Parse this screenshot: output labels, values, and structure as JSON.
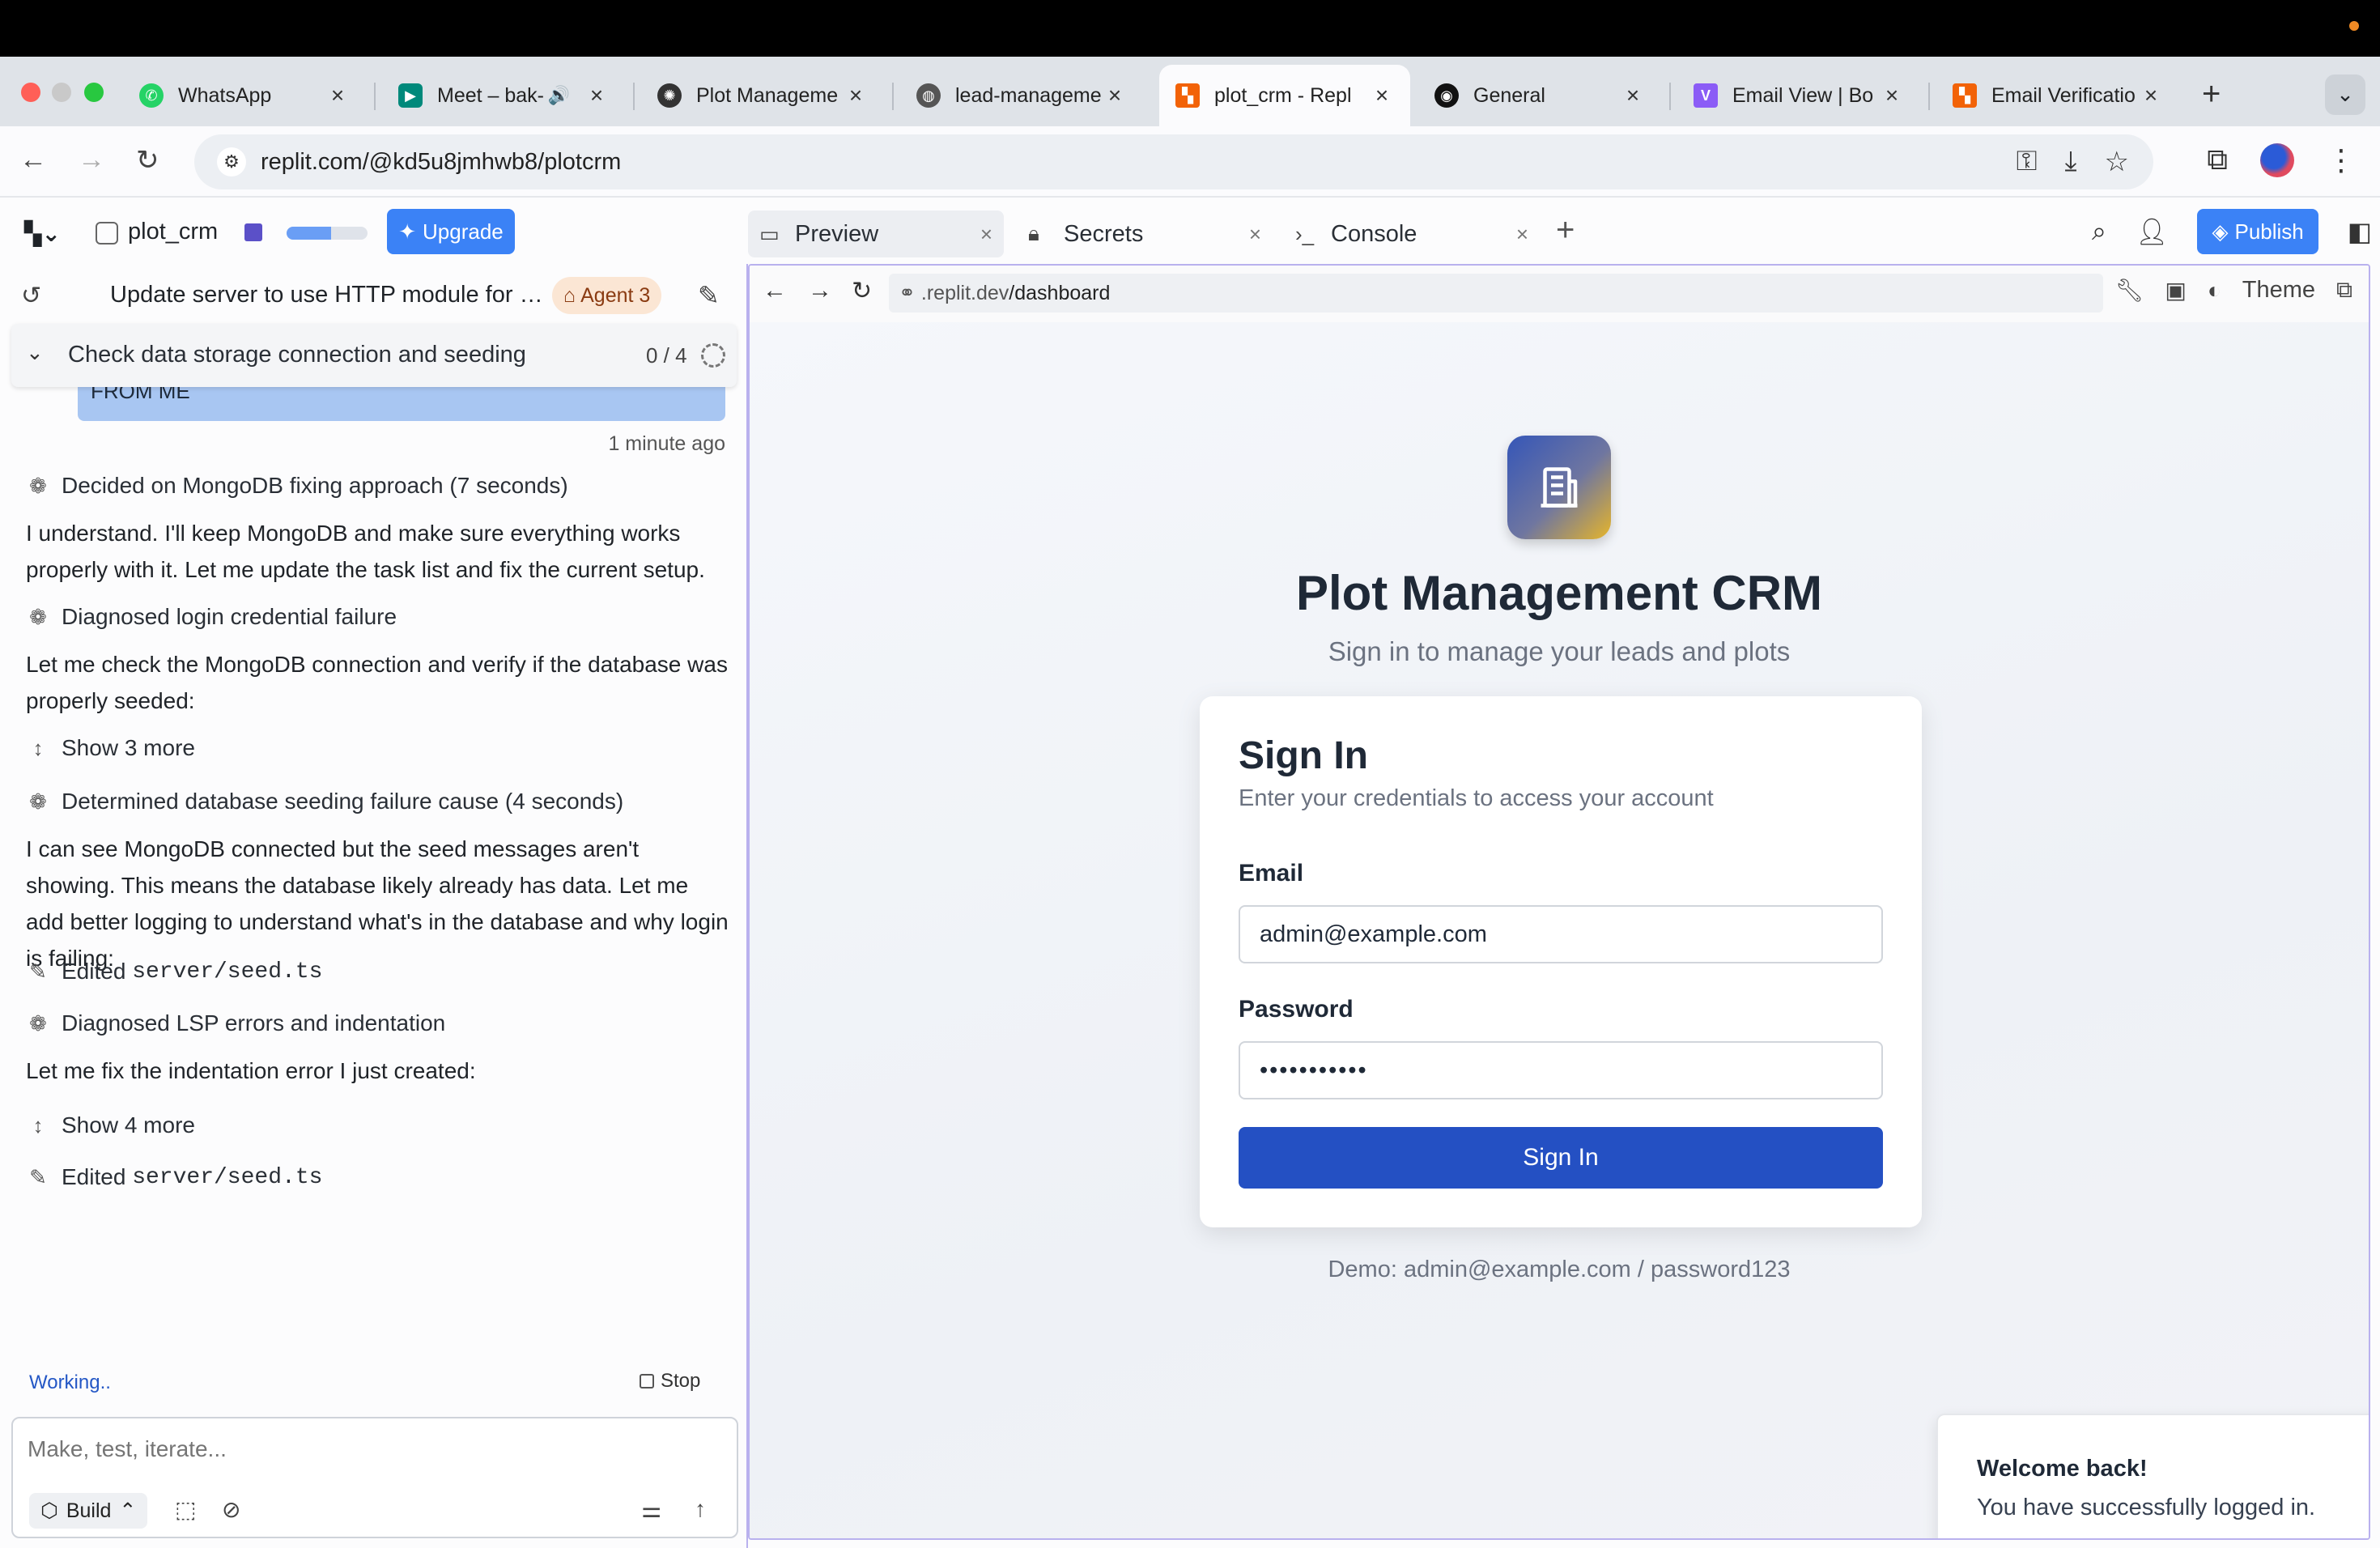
{
  "browser": {
    "tabs": [
      {
        "title": "WhatsApp",
        "favicon": "whatsapp-icon",
        "color": "#25d366"
      },
      {
        "title": "Meet – bak-",
        "favicon": "google-meet-icon",
        "color": "#00897b",
        "audio": "speaker-icon"
      },
      {
        "title": "Plot Manageme",
        "favicon": "chatgpt-icon",
        "color": "#333333"
      },
      {
        "title": "lead-manageme",
        "favicon": "globe-icon",
        "color": "#555555"
      },
      {
        "title": "plot_crm - Repl",
        "favicon": "replit-icon",
        "color": "#f26207",
        "active": true
      },
      {
        "title": "General",
        "favicon": "github-icon",
        "color": "#111111"
      },
      {
        "title": "Email View | Bo",
        "favicon": "vite-icon",
        "color": "#8b5cf6"
      },
      {
        "title": "Email Verificatio",
        "favicon": "replit-icon",
        "color": "#f26207"
      }
    ],
    "address": "replit.com/@kd5u8jmhwb8/plotcrm"
  },
  "workspace": {
    "project_name": "plot_crm",
    "progress_fraction": 0.55,
    "upgrade_label": "Upgrade",
    "chat_title": "Update server to use HTTP module for li...",
    "agent_badge": "Agent 3",
    "task": {
      "label": "Check data storage connection and seeding",
      "count": "0 / 4"
    },
    "user_bubble_text": "FROM ME",
    "message_time": "1 minute ago",
    "log": [
      {
        "kind": "step",
        "icon": "brain-icon",
        "text": "Decided on MongoDB fixing approach (7 seconds)"
      },
      {
        "kind": "para",
        "text": "I understand. I'll keep MongoDB and make sure everything works properly with it. Let me update the task list and fix the current setup."
      },
      {
        "kind": "step",
        "icon": "brain-icon",
        "text": "Diagnosed login credential failure"
      },
      {
        "kind": "para",
        "text": "Let me check the MongoDB connection and verify if the database was properly seeded:"
      },
      {
        "kind": "step",
        "icon": "expand-icon",
        "text": "Show 3 more"
      },
      {
        "kind": "step",
        "icon": "brain-icon",
        "text": "Determined database seeding failure cause (4 seconds)"
      },
      {
        "kind": "para",
        "text": "I can see MongoDB connected but the seed messages aren't showing. This means the database likely already has data. Let me add better logging to understand what's in the database and why login is failing:"
      },
      {
        "kind": "edit",
        "icon": "edit-file-icon",
        "prefix": "Edited",
        "code": "server/seed.ts"
      },
      {
        "kind": "step",
        "icon": "brain-icon",
        "text": "Diagnosed LSP errors and indentation"
      },
      {
        "kind": "para",
        "text": "Let me fix the indentation error I just created:"
      },
      {
        "kind": "step",
        "icon": "expand-icon",
        "text": "Show 4 more"
      },
      {
        "kind": "edit",
        "icon": "edit-file-icon",
        "prefix": "Edited",
        "code": "server/seed.ts"
      }
    ],
    "working_label": "Working..",
    "stop_label": "Stop",
    "composer_placeholder": "Make, test, iterate...",
    "build_label": "Build"
  },
  "right_pane": {
    "tabs": [
      {
        "label": "Preview",
        "icon": "monitor-icon"
      },
      {
        "label": "Secrets",
        "icon": "lock-icon"
      },
      {
        "label": "Console",
        "icon": "terminal-icon"
      }
    ],
    "publish_label": "Publish",
    "preview_url_prefix": ".replit.dev",
    "preview_url_path": "/dashboard",
    "theme_label": "Theme"
  },
  "app": {
    "title": "Plot Management CRM",
    "subtitle": "Sign in to manage your leads and plots",
    "card_title": "Sign In",
    "card_subtitle": "Enter your credentials to access your account",
    "email_label": "Email",
    "email_value": "admin@example.com",
    "password_label": "Password",
    "password_value": "•••••••••••",
    "signin_button": "Sign In",
    "demo_hint": "Demo: admin@example.com / password123",
    "toast_title": "Welcome back!",
    "toast_body": "You have successfully logged in."
  },
  "colors": {
    "accent_blue": "#3b82f6",
    "signin_blue": "#2450c3",
    "agent_badge_bg": "#fbe6d4"
  }
}
